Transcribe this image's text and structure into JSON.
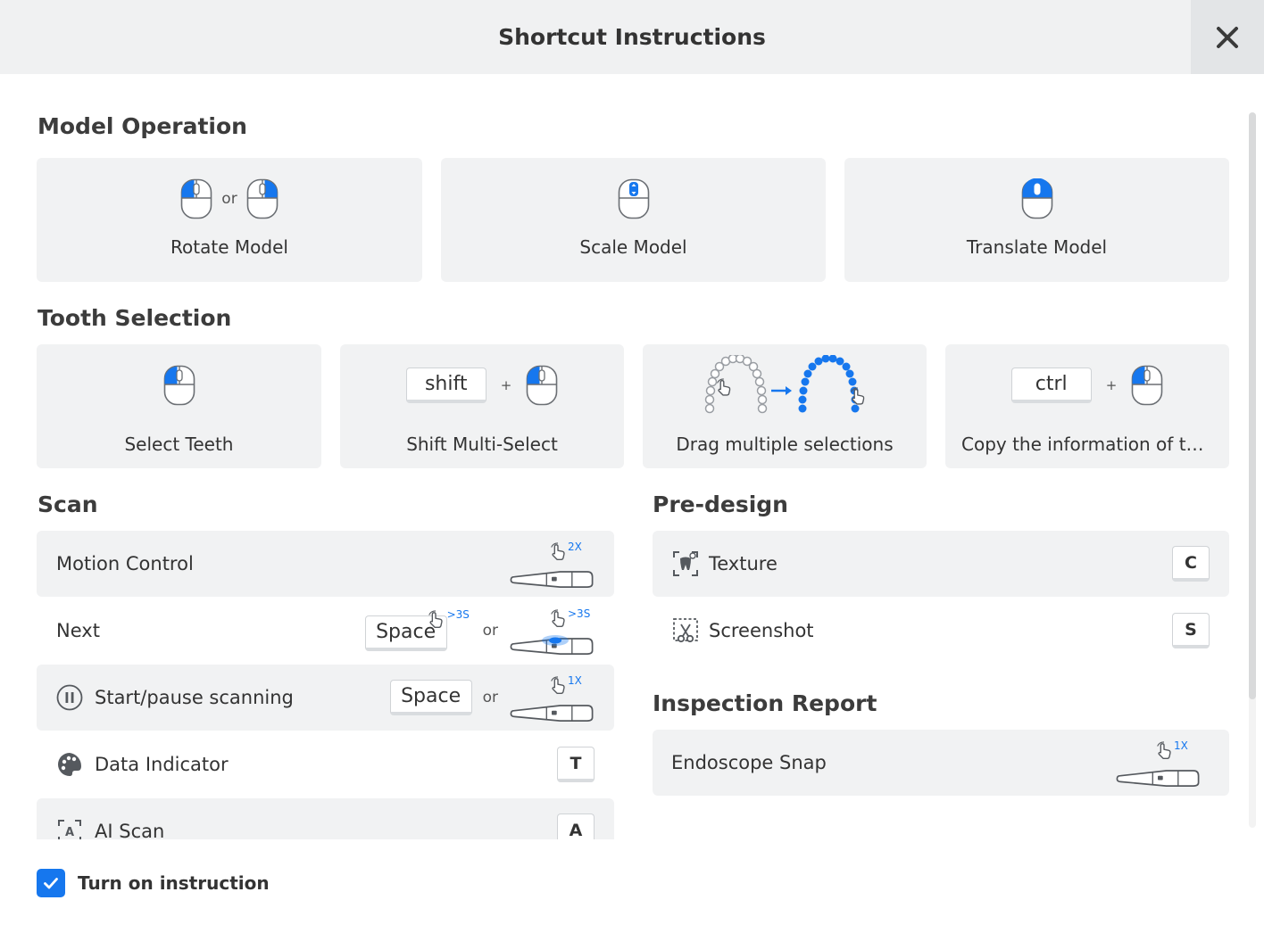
{
  "header": {
    "title": "Shortcut Instructions"
  },
  "colors": {
    "accent": "#1677ee",
    "card_bg": "#f1f2f3",
    "header_bg": "#f0f1f2"
  },
  "sections": {
    "model_operation": {
      "title": "Model Operation",
      "cards": [
        {
          "label": "Rotate Model",
          "or": "or",
          "icon": "mouse-left-or-right-icon"
        },
        {
          "label": "Scale Model",
          "icon": "mouse-scroll-icon"
        },
        {
          "label": "Translate Model",
          "icon": "mouse-middle-icon"
        }
      ]
    },
    "tooth_selection": {
      "title": "Tooth Selection",
      "cards": [
        {
          "label": "Select Teeth",
          "icon": "mouse-left-icon"
        },
        {
          "label": "Shift Multi-Select",
          "key": "shift",
          "plus": "+",
          "icon": "mouse-left-icon"
        },
        {
          "label": "Drag multiple selections",
          "icon": "drag-teeth-icon"
        },
        {
          "label": "Copy the information of th...",
          "key": "ctrl",
          "plus": "+",
          "icon": "mouse-left-icon"
        }
      ]
    },
    "scan": {
      "title": "Scan",
      "rows": [
        {
          "label": "Motion Control",
          "badge": "2X",
          "icon": "scanner-tap-icon"
        },
        {
          "label": "Next",
          "key": "Space",
          "key_badge": ">3S",
          "or": "or",
          "badge": ">3S",
          "icon": "scanner-hold-icon"
        },
        {
          "label": "Start/pause scanning",
          "key": "Space",
          "or": "or",
          "badge": "1X",
          "icon": "pause-circle-icon"
        },
        {
          "label": "Data Indicator",
          "key": "T",
          "icon": "palette-icon"
        },
        {
          "label": "AI Scan",
          "key": "A",
          "icon": "ai-scan-icon"
        }
      ]
    },
    "pre_design": {
      "title": "Pre-design",
      "rows": [
        {
          "label": "Texture",
          "key": "C",
          "icon": "texture-icon"
        },
        {
          "label": "Screenshot",
          "key": "S",
          "icon": "screenshot-icon"
        }
      ]
    },
    "inspection_report": {
      "title": "Inspection Report",
      "rows": [
        {
          "label": "Endoscope Snap",
          "badge": "1X",
          "icon": "scanner-tap-icon"
        }
      ]
    }
  },
  "footer": {
    "checkbox_label": "Turn on instruction",
    "checked": true
  }
}
